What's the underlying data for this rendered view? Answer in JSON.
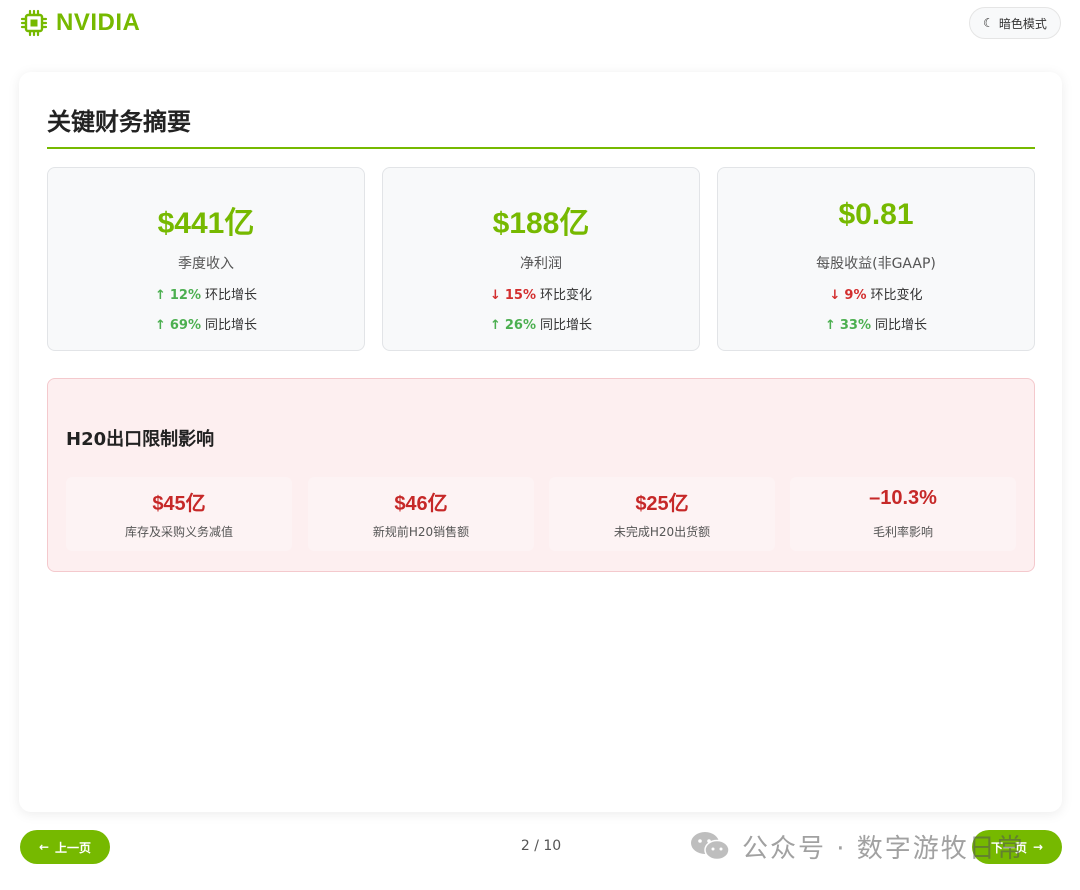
{
  "header": {
    "brand_name": "NVIDIA",
    "theme_toggle_label": "暗色模式",
    "brand_color": "#76b900"
  },
  "slide": {
    "title": "关键财务摘要",
    "metrics": [
      {
        "value": "$441亿",
        "label": "季度收入",
        "changes": [
          {
            "arrow": "↑",
            "direction": "up",
            "pct": "12%",
            "text": "环比增长"
          },
          {
            "arrow": "↑",
            "direction": "up",
            "pct": "69%",
            "text": "同比增长"
          }
        ]
      },
      {
        "value": "$188亿",
        "label": "净利润",
        "changes": [
          {
            "arrow": "↓",
            "direction": "down",
            "pct": "15%",
            "text": "环比变化"
          },
          {
            "arrow": "↑",
            "direction": "up",
            "pct": "26%",
            "text": "同比增长"
          }
        ]
      },
      {
        "value": "$0.81",
        "label": "每股收益(非GAAP)",
        "changes": [
          {
            "arrow": "↓",
            "direction": "down",
            "pct": "9%",
            "text": "环比变化"
          },
          {
            "arrow": "↑",
            "direction": "up",
            "pct": "33%",
            "text": "同比增长"
          }
        ]
      }
    ],
    "impact": {
      "title": "H20出口限制影响",
      "items": [
        {
          "value": "$45亿",
          "label": "库存及采购义务减值"
        },
        {
          "value": "$46亿",
          "label": "新规前H20销售额"
        },
        {
          "value": "$25亿",
          "label": "未完成H20出货额"
        },
        {
          "value": "–10.3%",
          "label": "毛利率影响"
        }
      ]
    }
  },
  "footer": {
    "prev_label": "上一页",
    "next_label": "下一页",
    "page_current": "2",
    "page_separator": "/",
    "page_total": "10",
    "watermark": "公众号 · 数字游牧日常"
  },
  "colors": {
    "accent": "#76b900",
    "up": "#4caf50",
    "down": "#d32f2f",
    "impact_value": "#c62828",
    "impact_bg": "#fdeff0"
  }
}
